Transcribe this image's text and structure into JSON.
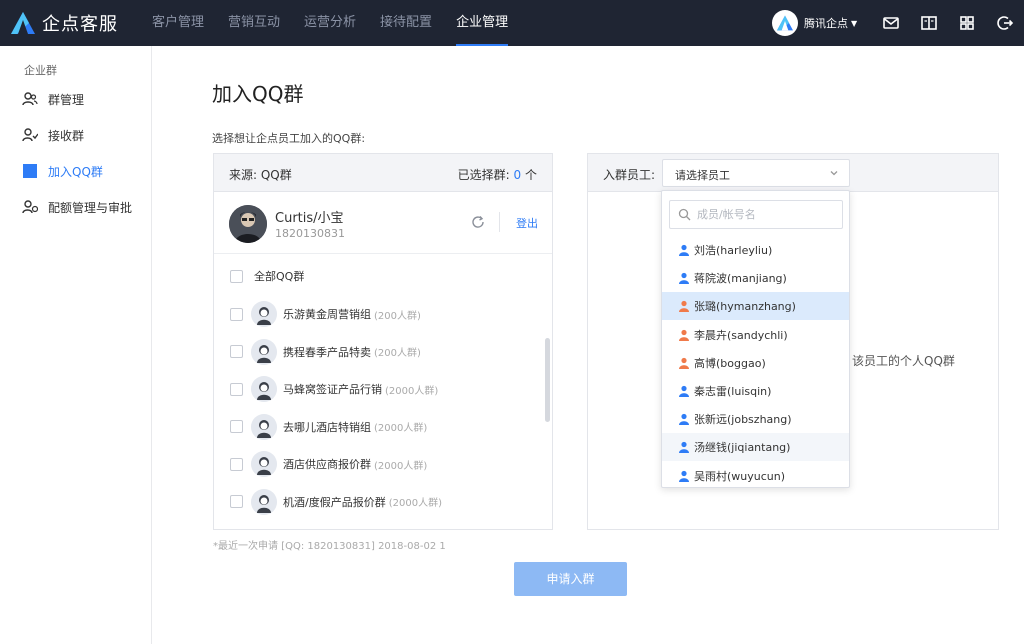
{
  "brand": {
    "name": "企点客服"
  },
  "nav": {
    "items": [
      {
        "label": "客户管理",
        "active": false
      },
      {
        "label": "营销互动",
        "active": false
      },
      {
        "label": "运营分析",
        "active": false
      },
      {
        "label": "接待配置",
        "active": false
      },
      {
        "label": "企业管理",
        "active": true
      }
    ]
  },
  "user": {
    "name": "腾讯企点"
  },
  "sidebar": {
    "section_title": "企业群",
    "items": [
      {
        "label": "群管理",
        "icon": "group-icon",
        "active": false
      },
      {
        "label": "接收群",
        "icon": "receive-group-icon",
        "active": false
      },
      {
        "label": "加入QQ群",
        "icon": "square-icon",
        "active": true
      },
      {
        "label": "配额管理与审批",
        "icon": "quota-icon",
        "active": false
      }
    ]
  },
  "page": {
    "title": "加入QQ群",
    "instruction": "选择想让企点员工加入的QQ群:",
    "source_label": "来源:  QQ群",
    "selected_prefix": "已选择群: ",
    "selected_count": "0",
    "selected_suffix": " 个",
    "account": {
      "name": "Curtis/小宝",
      "qq": "1820130831",
      "logout_label": "登出"
    },
    "all_groups_label": "全部QQ群",
    "groups": [
      {
        "name": "乐游黄金周营销组",
        "size": "(200人群)"
      },
      {
        "name": "携程春季产品特卖",
        "size": "(200人群)"
      },
      {
        "name": "马蜂窝签证产品行销",
        "size": "(2000人群)"
      },
      {
        "name": "去哪儿酒店特销组",
        "size": "(2000人群)"
      },
      {
        "name": "酒店供应商报价群",
        "size": "(2000人群)"
      },
      {
        "name": "机酒/度假产品报价群",
        "size": "(2000人群)"
      }
    ],
    "footnote": "*最近一次申请 [QQ: 1820130831] 2018-08-02 1",
    "apply_button": "申请入群",
    "member_label": "入群员工:",
    "member_placeholder": "请选择员工",
    "hint_text": "该员工的个人QQ群"
  },
  "dropdown": {
    "search_placeholder": "成员/帐号名",
    "items": [
      {
        "label": "刘浩(harleyliu)",
        "gender": "male",
        "state": ""
      },
      {
        "label": "蒋院波(manjiang)",
        "gender": "male",
        "state": ""
      },
      {
        "label": "张璐(hymanzhang)",
        "gender": "female",
        "state": "selected"
      },
      {
        "label": "李晨卉(sandychli)",
        "gender": "female",
        "state": ""
      },
      {
        "label": "高博(boggao)",
        "gender": "female",
        "state": ""
      },
      {
        "label": "秦志雷(luisqin)",
        "gender": "male",
        "state": ""
      },
      {
        "label": "张新远(jobszhang)",
        "gender": "male",
        "state": ""
      },
      {
        "label": "汤继钱(jiqiantang)",
        "gender": "male",
        "state": "hover"
      },
      {
        "label": "吴雨村(wuyucun)",
        "gender": "male",
        "state": ""
      }
    ]
  },
  "colors": {
    "accent": "#2e7cf6",
    "topbar": "#1f2533",
    "male_icon": "#2e7cf6",
    "female_icon": "#f07a4a",
    "selected_bg": "#dbeafc"
  }
}
